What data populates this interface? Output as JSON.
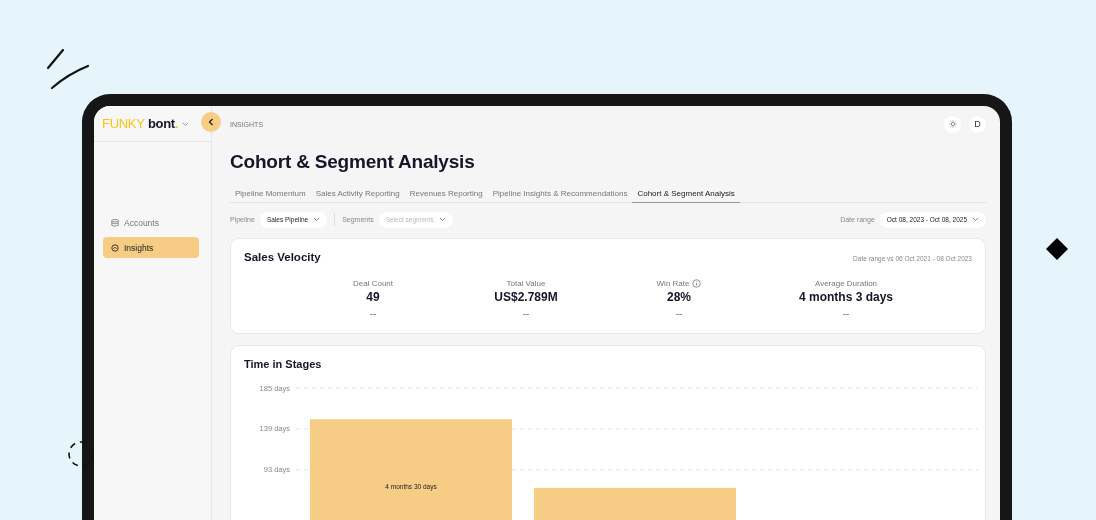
{
  "logo": {
    "brand": "FUNKY",
    "name": "bont",
    "mark": "."
  },
  "sidebar": {
    "items": [
      {
        "label": "Accounts",
        "selected": false
      },
      {
        "label": "Insights",
        "selected": true
      }
    ]
  },
  "breadcrumb": "INSIGHTS",
  "header": {
    "avatar": "D"
  },
  "page_title": "Cohort & Segment Analysis",
  "tabs": [
    {
      "label": "Pipeline Momentum",
      "selected": false
    },
    {
      "label": "Sales Activity Reporting",
      "selected": false
    },
    {
      "label": "Revenues Reporting",
      "selected": false
    },
    {
      "label": "Pipeline Insights & Recommendations",
      "selected": false
    },
    {
      "label": "Cohort & Segment Analysis",
      "selected": true
    }
  ],
  "filters": {
    "pipeline": {
      "label": "Pipeline",
      "value": "Sales Pipeline"
    },
    "segments": {
      "label": "Segments",
      "placeholder": "Select segments"
    },
    "date_range": {
      "label": "Date range",
      "value": "Oct 08, 2023 - Oct 08, 2025"
    }
  },
  "sales_velocity": {
    "title": "Sales Velocity",
    "comparison": "Date range vs 06 Oct 2021 - 08 Oct 2023",
    "metrics": [
      {
        "label": "Deal Count",
        "value": "49",
        "change": "--",
        "info": false
      },
      {
        "label": "Total Value",
        "value": "US$2.789M",
        "change": "--",
        "info": false
      },
      {
        "label": "Win Rate",
        "value": "28%",
        "change": "--",
        "info": true
      },
      {
        "label": "Average Duration",
        "value": "4 months 3 days",
        "change": "--",
        "info": false
      }
    ]
  },
  "time_in_stages": {
    "title": "Time in Stages",
    "chart_data": {
      "type": "bar",
      "ylim": [
        0,
        185
      ],
      "yticks": [
        {
          "value": 93,
          "label": "93 days"
        },
        {
          "value": 139,
          "label": "139 days"
        },
        {
          "value": 185,
          "label": "185 days"
        }
      ],
      "series": [
        {
          "color": "#f7cd86",
          "values": [
            150,
            73
          ]
        }
      ],
      "value_labels": [
        "4 months 30 days",
        null
      ]
    }
  }
}
